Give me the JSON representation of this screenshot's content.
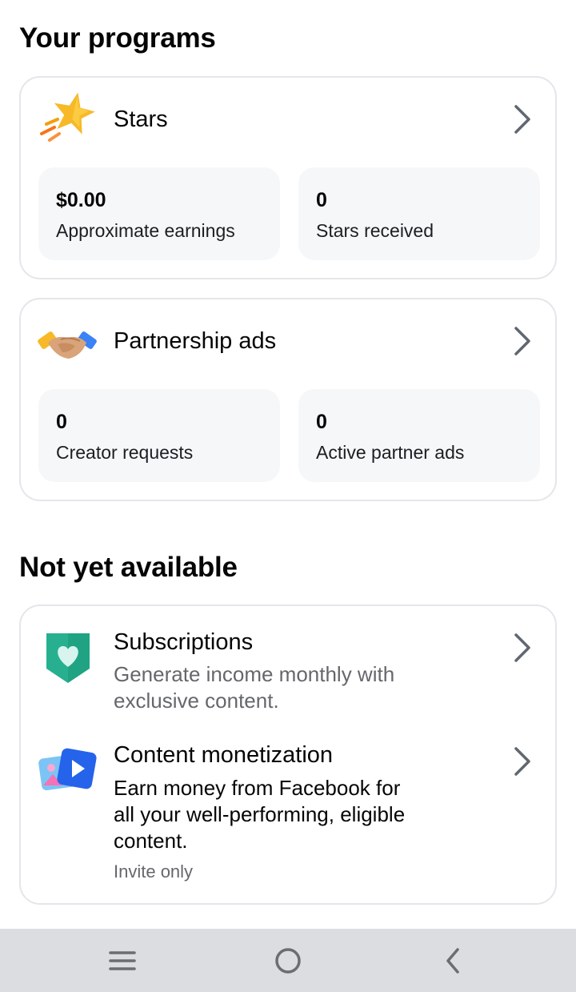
{
  "sections": {
    "programs_title": "Your programs",
    "unavailable_title": "Not yet available"
  },
  "stars": {
    "title": "Stars",
    "icon": "star-icon",
    "stats": [
      {
        "value": "$0.00",
        "label": "Approximate earnings"
      },
      {
        "value": "0",
        "label": "Stars received"
      }
    ]
  },
  "partnership": {
    "title": "Partnership ads",
    "icon": "handshake-icon",
    "stats": [
      {
        "value": "0",
        "label": "Creator requests"
      },
      {
        "value": "0",
        "label": "Active partner ads"
      }
    ]
  },
  "unavailable": [
    {
      "title": "Subscriptions",
      "icon": "heart-badge-icon",
      "desc_lines": [
        "Generate income monthly with",
        "exclusive content."
      ],
      "note": ""
    },
    {
      "title": "Content monetization",
      "icon": "media-icon",
      "desc_lines": [
        "Earn money from Facebook for",
        "all your well-performing, eligible",
        "content."
      ],
      "note": "Invite only"
    }
  ],
  "nav": {
    "menu": "menu-icon",
    "home": "home-circle-icon",
    "back": "back-icon"
  },
  "colors": {
    "text_primary": "#050505",
    "text_secondary": "#65676b",
    "card_border": "#e4e6ea",
    "stat_bg": "#f6f7f9",
    "navbar_bg": "#dcdde0"
  }
}
